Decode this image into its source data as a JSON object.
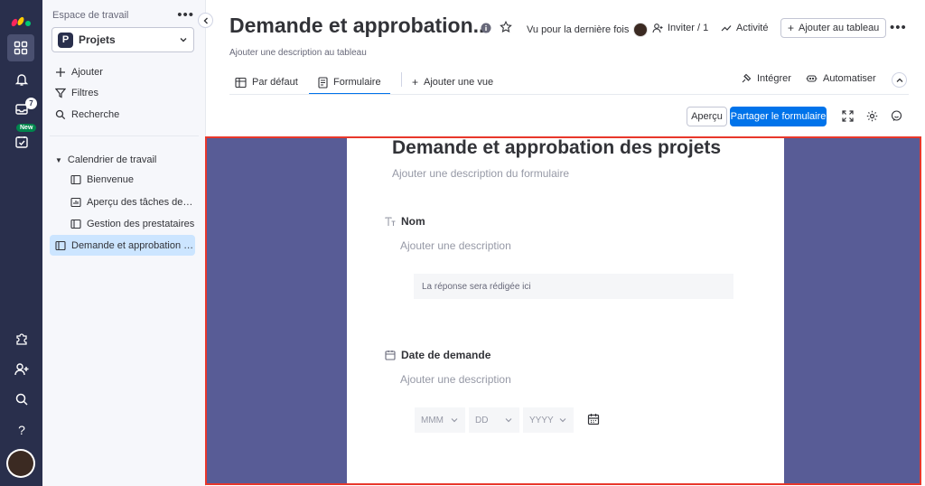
{
  "sidebar": {
    "workspace_label": "Espace de travail",
    "workspace_menu": "•••",
    "workspace_letter": "P",
    "workspace_name": "Projets",
    "actions": {
      "add": "Ajouter",
      "filters": "Filtres",
      "search": "Recherche"
    },
    "folder": "Calendrier de travail",
    "items": [
      {
        "label": "Bienvenue",
        "icon": "board-icon"
      },
      {
        "label": "Aperçu des tâches de l'...",
        "icon": "dashboard-icon"
      },
      {
        "label": "Gestion des prestataires",
        "icon": "board-icon"
      },
      {
        "label": "Demande et approbation d...",
        "icon": "board-icon",
        "active": true
      }
    ]
  },
  "rail": {
    "inbox_count": "7",
    "new_badge": "New"
  },
  "header": {
    "title": "Demande et approbation...",
    "last_seen": "Vu pour la dernière fois",
    "invite": "Inviter / 1",
    "activity": "Activité",
    "add_to_board": "Ajouter au tableau",
    "more": "•••",
    "description": "Ajouter une description au tableau"
  },
  "tabs": [
    {
      "label": "Par défaut",
      "icon": "table-icon"
    },
    {
      "label": "Formulaire",
      "icon": "form-icon",
      "active": true
    },
    {
      "label": "Ajouter une vue",
      "icon": "plus-icon"
    }
  ],
  "toolbar": {
    "integrate": "Intégrer",
    "automate": "Automatiser",
    "preview": "Aperçu",
    "share_form": "Partager le formulaire"
  },
  "form": {
    "title": "Demande et approbation des projets",
    "description": "Ajouter une description du formulaire",
    "questions": [
      {
        "title": "Nom",
        "description": "Ajouter une description",
        "answer_placeholder": "La réponse sera rédigée ici"
      },
      {
        "title": "Date de demande",
        "description": "Ajouter une description",
        "date_parts": [
          "MMM",
          "DD",
          "YYYY"
        ]
      }
    ]
  },
  "colors": {
    "accent": "#0073ea",
    "rail": "#292f4c",
    "canvas": "#585c96",
    "highlight": "#e8372b",
    "active_item": "#cce5ff"
  }
}
